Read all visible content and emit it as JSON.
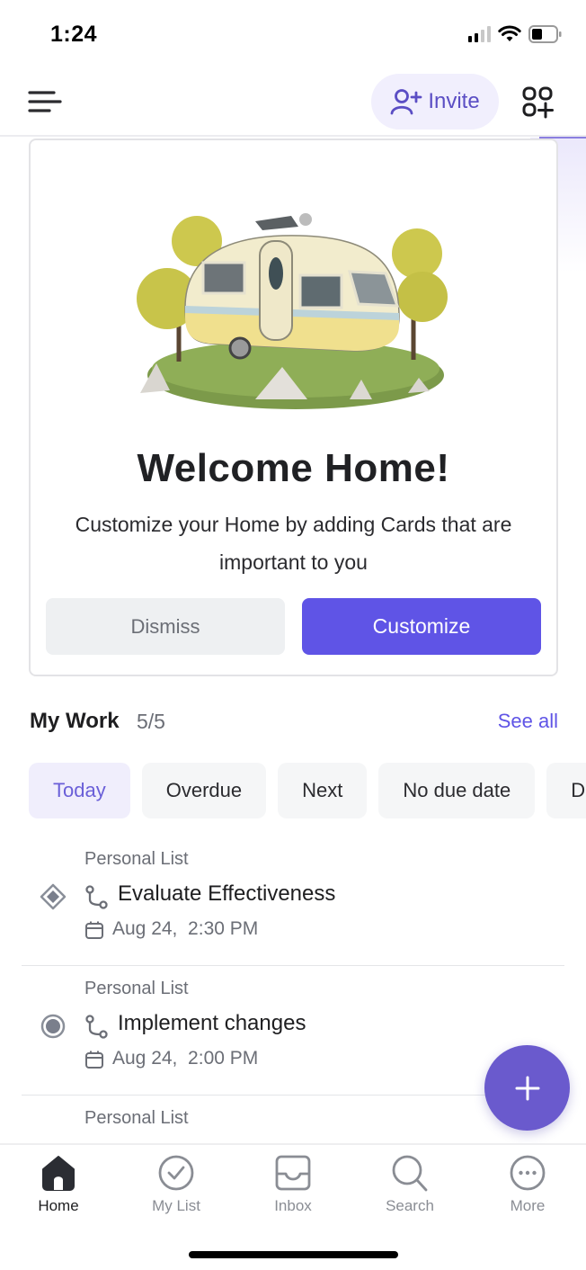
{
  "status_bar": {
    "time": "1:24",
    "signal_icon": "cellular-signal-icon",
    "wifi_icon": "wifi-icon",
    "battery_icon": "battery-icon"
  },
  "header": {
    "menu_icon": "hamburger-menu-icon",
    "invite_label": "Invite",
    "invite_icon": "add-user-icon",
    "apps_icon": "add-app-grid-icon"
  },
  "welcome_card": {
    "illustration": "camper-trailer-illustration",
    "title": "Welcome Home!",
    "subtitle": "Customize your Home by adding Cards that are important to you",
    "dismiss_label": "Dismiss",
    "customize_label": "Customize"
  },
  "my_work": {
    "title": "My Work",
    "count": "5/5",
    "see_all_label": "See all",
    "tabs": [
      {
        "label": "Today",
        "active": true
      },
      {
        "label": "Overdue",
        "active": false
      },
      {
        "label": "Next",
        "active": false
      },
      {
        "label": "No due date",
        "active": false
      },
      {
        "label": "D",
        "active": false
      }
    ],
    "tasks": [
      {
        "list": "Personal List",
        "title": "Evaluate Effectiveness",
        "due": "Aug 24,  2:30 PM",
        "status_icon": "diamond-status-icon",
        "type_icon": "subtask-icon",
        "date_icon": "calendar-icon"
      },
      {
        "list": "Personal List",
        "title": "Implement changes",
        "due": "Aug 24,  2:00 PM",
        "status_icon": "radio-status-icon",
        "type_icon": "subtask-icon",
        "date_icon": "calendar-icon"
      },
      {
        "list": "Personal List",
        "title": "",
        "due": "",
        "status_icon": "",
        "type_icon": "",
        "date_icon": ""
      }
    ]
  },
  "fab": {
    "icon": "plus-icon"
  },
  "bottom_nav": {
    "items": [
      {
        "label": "Home",
        "icon": "home-icon",
        "active": true
      },
      {
        "label": "My List",
        "icon": "check-circle-icon",
        "active": false
      },
      {
        "label": "Inbox",
        "icon": "inbox-icon",
        "active": false
      },
      {
        "label": "Search",
        "icon": "search-icon",
        "active": false
      },
      {
        "label": "More",
        "icon": "more-icon",
        "active": false
      }
    ]
  },
  "colors": {
    "accent": "#5f54e6",
    "fab": "#6a5acd",
    "invite_bg": "#f1effd",
    "chip_active_bg": "#f0eefc",
    "muted_text": "#6b6e76"
  }
}
